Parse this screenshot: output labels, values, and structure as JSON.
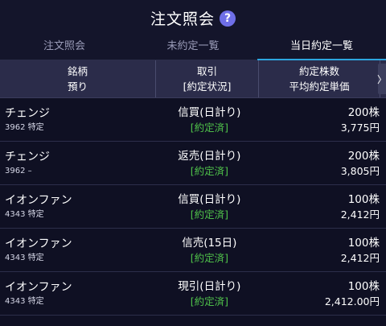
{
  "header": {
    "title": "注文照会",
    "help_icon_text": "?"
  },
  "tabs": [
    {
      "label": "注文照会"
    },
    {
      "label": "未約定一覧"
    },
    {
      "label": "当日約定一覧"
    }
  ],
  "table_header": {
    "col1_line1": "銘柄",
    "col1_line2": "預り",
    "col2_line1": "取引",
    "col2_line2": "[約定状況]",
    "col3_line1": "約定株数",
    "col3_line2": "平均約定単価",
    "scroll_arrow": "〉"
  },
  "rows": [
    {
      "name": "チェンジ",
      "code": "3962 特定",
      "trade": "信買(日計り)",
      "status": "[約定済]",
      "qty": "200株",
      "price": "3,775円"
    },
    {
      "name": "チェンジ",
      "code": "3962 –",
      "trade": "返売(日計り)",
      "status": "[約定済]",
      "qty": "200株",
      "price": "3,805円"
    },
    {
      "name": "イオンファン",
      "code": "4343 特定",
      "trade": "信買(日計り)",
      "status": "[約定済]",
      "qty": "100株",
      "price": "2,412円"
    },
    {
      "name": "イオンファン",
      "code": "4343 特定",
      "trade": "信売(15日)",
      "status": "[約定済]",
      "qty": "100株",
      "price": "2,412円"
    },
    {
      "name": "イオンファン",
      "code": "4343 特定",
      "trade": "現引(日計り)",
      "status": "[約定済]",
      "qty": "100株",
      "price": "2,412.00円"
    }
  ],
  "colors": {
    "accent": "#2da6e0",
    "status_green": "#4fc24a",
    "background": "#0f1023"
  }
}
